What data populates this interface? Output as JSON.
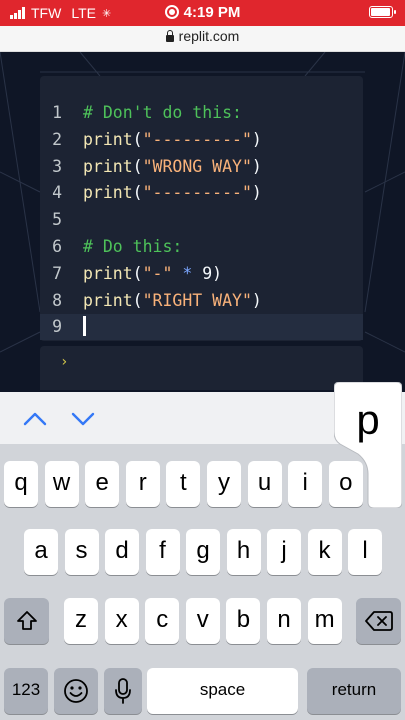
{
  "status": {
    "carrier": "TFW",
    "network": "LTE",
    "time": "4:19 PM",
    "bg_color": "#e0262d"
  },
  "url": {
    "host": "replit.com"
  },
  "editor": {
    "lines": [
      {
        "num": "1",
        "parts": [
          {
            "t": "# Don't do this:",
            "c": "cm"
          }
        ]
      },
      {
        "num": "2",
        "parts": [
          {
            "t": "print",
            "c": "fn"
          },
          {
            "t": "(",
            "c": "nm"
          },
          {
            "t": "\"---------\"",
            "c": "st"
          },
          {
            "t": ")",
            "c": "nm"
          }
        ]
      },
      {
        "num": "3",
        "parts": [
          {
            "t": "print",
            "c": "fn"
          },
          {
            "t": "(",
            "c": "nm"
          },
          {
            "t": "\"WRONG WAY\"",
            "c": "st"
          },
          {
            "t": ")",
            "c": "nm"
          }
        ]
      },
      {
        "num": "4",
        "parts": [
          {
            "t": "print",
            "c": "fn"
          },
          {
            "t": "(",
            "c": "nm"
          },
          {
            "t": "\"---------\"",
            "c": "st"
          },
          {
            "t": ")",
            "c": "nm"
          }
        ]
      },
      {
        "num": "5",
        "parts": []
      },
      {
        "num": "6",
        "parts": [
          {
            "t": "# Do this:",
            "c": "cm"
          }
        ]
      },
      {
        "num": "7",
        "parts": [
          {
            "t": "print",
            "c": "fn"
          },
          {
            "t": "(",
            "c": "nm"
          },
          {
            "t": "\"-\"",
            "c": "st"
          },
          {
            "t": " ",
            "c": "nm"
          },
          {
            "t": "*",
            "c": "op"
          },
          {
            "t": " 9",
            "c": "nm"
          },
          {
            "t": ")",
            "c": "nm"
          }
        ]
      },
      {
        "num": "8",
        "parts": [
          {
            "t": "print",
            "c": "fn"
          },
          {
            "t": "(",
            "c": "nm"
          },
          {
            "t": "\"RIGHT WAY\"",
            "c": "st"
          },
          {
            "t": ")",
            "c": "nm"
          }
        ]
      },
      {
        "num": "9",
        "parts": [],
        "active": true,
        "cursor": true
      }
    ]
  },
  "console": {
    "prompt": "›"
  },
  "keyboard": {
    "popup_key": "p",
    "row1": [
      "q",
      "w",
      "e",
      "r",
      "t",
      "y",
      "u",
      "i",
      "o"
    ],
    "row2": [
      "a",
      "s",
      "d",
      "f",
      "g",
      "h",
      "j",
      "k",
      "l"
    ],
    "row3": [
      "z",
      "x",
      "c",
      "v",
      "b",
      "n",
      "m"
    ],
    "numbers_label": "123",
    "space_label": "space",
    "return_label": "return",
    "icons": {
      "shift": "shift-icon",
      "backspace": "backspace-icon",
      "emoji": "emoji-icon",
      "mic": "microphone-icon",
      "up": "chevron-up-icon",
      "down": "chevron-down-icon"
    }
  }
}
